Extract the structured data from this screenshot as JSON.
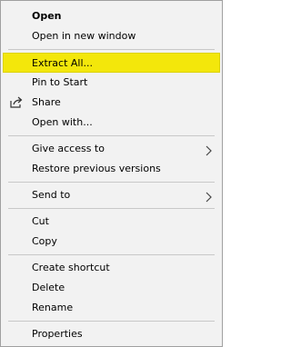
{
  "menu": {
    "open": "Open",
    "open_new_window": "Open in new window",
    "extract_all": "Extract All...",
    "pin_to_start": "Pin to Start",
    "share": "Share",
    "open_with": "Open with...",
    "give_access_to": "Give access to",
    "restore_previous_versions": "Restore previous versions",
    "send_to": "Send to",
    "cut": "Cut",
    "copy": "Copy",
    "create_shortcut": "Create shortcut",
    "delete": "Delete",
    "rename": "Rename",
    "properties": "Properties"
  },
  "colors": {
    "highlight": "#f3e70b",
    "menu_bg": "#f2f2f2",
    "separator": "#c8c8c8"
  },
  "icons": {
    "share": "share-icon",
    "submenu": "chevron-right-icon"
  }
}
